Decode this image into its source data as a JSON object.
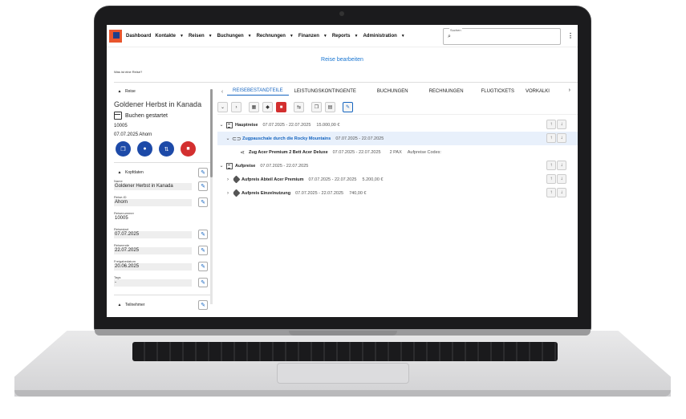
{
  "nav": {
    "items": [
      "Dashboard",
      "Kontakte",
      "Reisen",
      "Buchungen",
      "Rechnungen",
      "Finanzen",
      "Reports",
      "Administration"
    ],
    "search_label": "Suchen"
  },
  "page_title": "Reise bearbeiten",
  "help_link": "Was ist eine Reise?",
  "left": {
    "section_reise": "Reise",
    "trip_title": "Goldener Herbst in Kanada",
    "status": "Buchen gestartet",
    "trip_number": "10005",
    "trip_date_owner": "07.07.2025 Ahorn",
    "section_kopfdaten": "Kopfdaten",
    "fields": [
      {
        "label": "Name",
        "value": "Goldener Herbst in Kanada"
      },
      {
        "label": "Reise-ID",
        "value": "Ahorn"
      },
      {
        "label": "Reisenummer",
        "value": "10005"
      },
      {
        "label": "Reisestart",
        "value": "07.07.2025"
      },
      {
        "label": "Reiseende",
        "value": "22.07.2025"
      },
      {
        "label": "Freigabedatum",
        "value": "20.06.2025"
      },
      {
        "label": "Tags",
        "value": "-"
      }
    ],
    "section_teilnehmer": "Teilnehmer"
  },
  "tabs": [
    "REISEBESTANDTEILE",
    "LEISTUNGSKONTINGENTE",
    "BUCHUNGEN",
    "RECHNUNGEN",
    "FLUGTICKETS",
    "VORKALKI"
  ],
  "rows": [
    {
      "name": "Hauptreise",
      "dates": "07.07.2025 - 22.07.2025",
      "price": "15.000,00 €"
    },
    {
      "name": "Zugpauschale durch die Rocky Mountains",
      "dates": "07.07.2025 - 22.07.2025"
    },
    {
      "name": "Zug Acer Premium 2 Bett Acer Deluxe",
      "dates": "07.07.2025 - 22.07.2025",
      "pax": "2 PAX",
      "codes": "Aufpreise Codes:"
    },
    {
      "name": "Aufpreise",
      "dates": "07.07.2025 - 22.07.2025"
    },
    {
      "name": "Aufpreis Abteil Acer Premium",
      "dates": "07.07.2025 - 22.07.2025",
      "price": "5.200,00 €"
    },
    {
      "name": "Aufpreis Einzelnutzung",
      "dates": "07.07.2025 - 22.07.2025",
      "price": "740,00 €"
    }
  ],
  "colors": {
    "accent": "#1565c0",
    "danger": "#d32f2f",
    "brand": "#e8552d"
  }
}
